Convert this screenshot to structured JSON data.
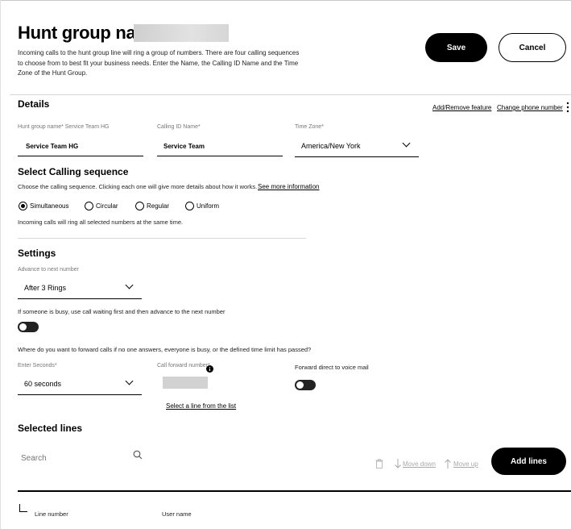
{
  "header": {
    "title": "Hunt group name",
    "intro": "Incoming calls to the hunt group line will ring a group of numbers. There are four calling sequences to choose from to best fit your business needs. Enter the Name, the Calling ID Name and the Time Zone of the Hunt Group.",
    "save_label": "Save",
    "cancel_label": "Cancel"
  },
  "details": {
    "title": "Details",
    "add_remove_feature": "Add/Remove feature",
    "change_phone_number": "Change phone number",
    "name_label": "Hunt group name* Service Team HG",
    "name_value": "Service Team HG",
    "calling_id_label": "Calling ID Name*",
    "calling_id_value": "Service Team",
    "timezone_label": "Time Zone*",
    "timezone_value": "America/New York"
  },
  "sequence": {
    "title": "Select Calling sequence",
    "description": "Choose the calling sequence. Clicking each one will give more details about how it works.",
    "more_info_link": "See more information",
    "options": [
      "Simultaneous",
      "Circular",
      "Regular",
      "Uniform"
    ],
    "selected": "Simultaneous",
    "selected_description": "Incoming calls will ring all selected numbers at the same time."
  },
  "settings": {
    "title": "Settings",
    "advance_label": "Advance to next number",
    "advance_value": "After 3 Rings",
    "busy_text": "If someone is busy, use call waiting first and then advance to the next number",
    "busy_toggle": "off",
    "forward_question": "Where do you want to forward calls if no one answers, everyone is busy, or the defined time limit has passed?",
    "enter_seconds_label": "Enter Seconds*",
    "enter_seconds_value": "60 seconds",
    "call_forward_label": "Call forward number*",
    "select_line_link": "Select a line from the list",
    "forward_voicemail_label": "Forward direct to voice mail",
    "voicemail_toggle": "off"
  },
  "lines": {
    "title": "Selected lines",
    "search_placeholder": "Search",
    "move_down": "Move down",
    "move_up": "Move up",
    "add_lines": "Add lines",
    "col_line_number": "Line number",
    "col_user_name": "User name"
  },
  "icons": {
    "search": "search-icon",
    "trash": "trash-icon",
    "arrow_down": "arrow-down-icon",
    "arrow_up": "arrow-up-icon",
    "info": "info-icon",
    "more": "more-vertical-icon",
    "chevron": "chevron-down-icon"
  }
}
